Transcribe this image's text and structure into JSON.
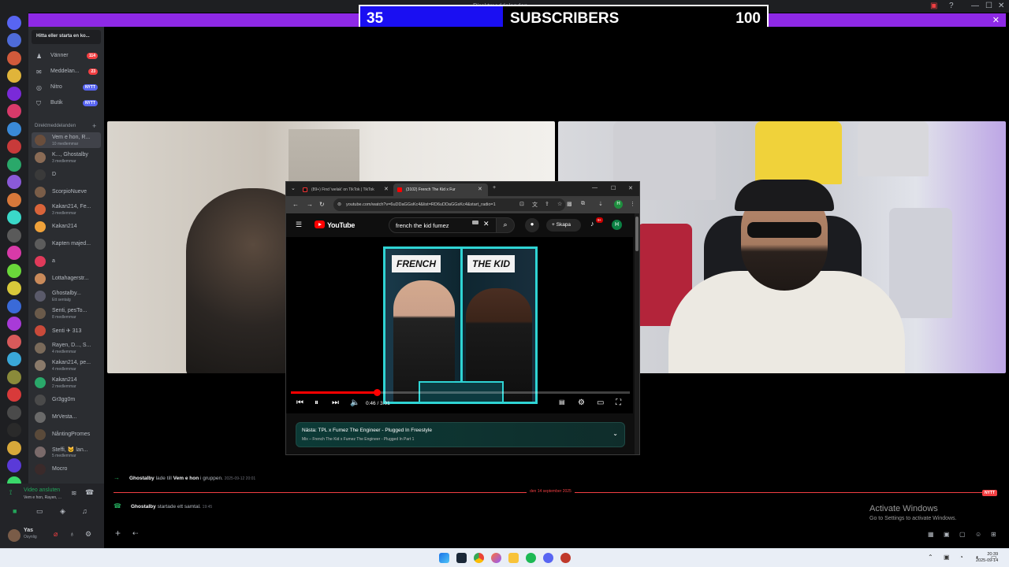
{
  "window": {
    "title": "Direktmeddelanden"
  },
  "overlay": {
    "current": "35",
    "label": "SUBSCRIBERS",
    "goal": "100",
    "progress_fraction": 0.35
  },
  "sidebar": {
    "search": "Hitta eller starta en ko...",
    "nav": [
      {
        "icon": "friends-icon",
        "label": "Vänner",
        "badge": "114"
      },
      {
        "icon": "mail-icon",
        "label": "Meddelan...",
        "badge": "23"
      },
      {
        "icon": "nitro-icon",
        "label": "Nitro",
        "badge": "NYTT"
      },
      {
        "icon": "shop-icon",
        "label": "Butik",
        "badge": "NYTT"
      }
    ],
    "dm_header": "Direktmeddelanden",
    "dms": [
      {
        "name": "Vem e hon, R...",
        "sub": "10 medlemmar",
        "color": "#6a4e3c",
        "active": true
      },
      {
        "name": "K..., Ghostalby",
        "sub": "3 medlemmar",
        "color": "#8a6b55"
      },
      {
        "name": "D",
        "sub": "",
        "color": "#3a3a3a"
      },
      {
        "name": "ScorpioNueve",
        "sub": "",
        "color": "#7a5d48"
      },
      {
        "name": "Kakan214, Fe...",
        "sub": "3 medlemmar",
        "color": "#d9643a"
      },
      {
        "name": "Kakan214",
        "sub": "",
        "color": "#f0a23a"
      },
      {
        "name": "Kapten majed...",
        "sub": "",
        "color": "#5c5c5c"
      },
      {
        "name": "a",
        "sub": "",
        "color": "#e03a5a"
      },
      {
        "name": "Lottahagerstr...",
        "sub": "",
        "color": "#c98a5a"
      },
      {
        "name": "Ghostalby...",
        "sub": "Ett sentalg",
        "color": "#5a5a6a"
      },
      {
        "name": "Senti, pesTo...",
        "sub": "8 medlemmar",
        "color": "#6a5a4a"
      },
      {
        "name": "Senti ✈ 313",
        "sub": "",
        "color": "#c94a3a"
      },
      {
        "name": "Rayen, D..., S...",
        "sub": "4 medlemmar",
        "color": "#7a6a5a"
      },
      {
        "name": "Kakan214, pe...",
        "sub": "4 medlemmar",
        "color": "#8a7a6a"
      },
      {
        "name": "Kakan214",
        "sub": "2 medlemmar",
        "color": "#2aa86a"
      },
      {
        "name": "Gr3gg0m",
        "sub": "",
        "color": "#4a4a4a"
      },
      {
        "name": "MrVesta...",
        "sub": "",
        "color": "#6a6a6a"
      },
      {
        "name": "NåntingPromes",
        "sub": "",
        "color": "#5a4a3a"
      },
      {
        "name": "Steffi, 🐱 lan...",
        "sub": "5 medlemmar",
        "color": "#7a6a6a"
      },
      {
        "name": "Mocro",
        "sub": "",
        "color": "#3a2a2a"
      }
    ],
    "voice": {
      "status": "Video ansluten",
      "channel": "Vem e hon, Rayen, ..."
    },
    "user": {
      "name": "Yas",
      "status": "Osynlig"
    }
  },
  "browser": {
    "tabs": [
      {
        "label": "(89+) Find 'welak' on TikTok | TikTok",
        "active": false
      },
      {
        "label": "(3102) French The Kid x Fur",
        "active": true
      }
    ],
    "url": "youtube.com/watch?v=6uDDaGGsKc4&list=RD6uDDaGGsKc4&start_radio=1",
    "profile": "H"
  },
  "youtube": {
    "logo": "YouTube",
    "search_query": "french the kid fumez",
    "create_label": "Skapa",
    "bell_badge": "9+",
    "avatar": "H",
    "thumb_label_left": "FRENCH",
    "thumb_label_right": "THE KID",
    "time": "0:46 / 3:01",
    "progress_fraction": 0.254,
    "up_next_title": "Nästa: TPL x Fumez The Engineer - Plugged In Freestyle",
    "up_next_sub": "Mix – French The Kid x Fumez The Engineer - Plugged In Part 1"
  },
  "chat": {
    "messages": [
      {
        "user": "Ghostalby",
        "text": " lade till ",
        "target": "Vem e hon",
        "tail": " i gruppen.",
        "time": "2025-09-12 20:01"
      },
      {
        "user": "Ghostalby",
        "text": " startade ett samtal.",
        "time": "19:45"
      }
    ],
    "date_separator": "den 14 september 2025",
    "new_badge": "NYTT"
  },
  "activation": {
    "title": "Activate Windows",
    "subtitle": "Go to Settings to activate Windows."
  },
  "clock": {
    "time": "20:39",
    "date": "2025-09-14"
  },
  "colors": {
    "discord_bg": "#2b2d31",
    "banner": "#8e29e6",
    "accent_red": "#f23f42",
    "overlay_fill": "#1a0ff2"
  }
}
